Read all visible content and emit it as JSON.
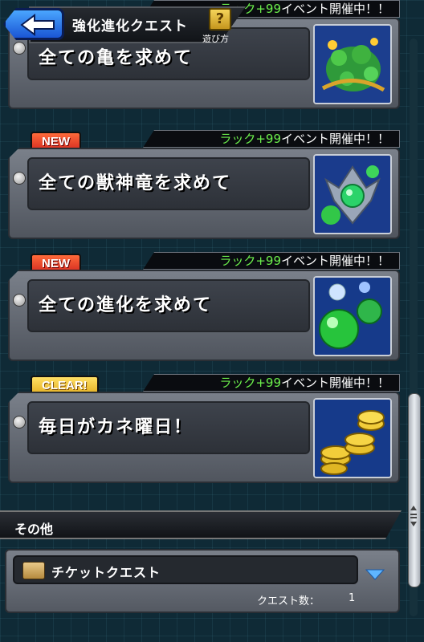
{
  "header": {
    "title": "強化進化クエスト",
    "help_label": "遊び方"
  },
  "event_text": {
    "prefix": "ラック+99",
    "suffix": "イベント開催中！！"
  },
  "quests": [
    {
      "title": "全ての亀を求めて",
      "badge": null,
      "thumbnail": "turtle-monster-icon"
    },
    {
      "title": "全ての獣神竜を求めて",
      "badge": "NEW",
      "thumbnail": "dragon-monster-icon"
    },
    {
      "title": "全ての進化を求めて",
      "badge": "NEW",
      "thumbnail": "evolution-orbs-icon"
    },
    {
      "title": "毎日がカネ曜日！",
      "badge": "CLEAR!",
      "thumbnail": "gold-coins-icon"
    }
  ],
  "other_section": {
    "title": "その他",
    "ticket_quest": {
      "label": "チケットクエスト",
      "count_label": "クエスト数：",
      "count_value": "1"
    }
  },
  "colors": {
    "badge_new": "#d0241e",
    "badge_clear": "#e0a818",
    "event_green": "#6cf04c",
    "back_button": "#1a55d4"
  }
}
